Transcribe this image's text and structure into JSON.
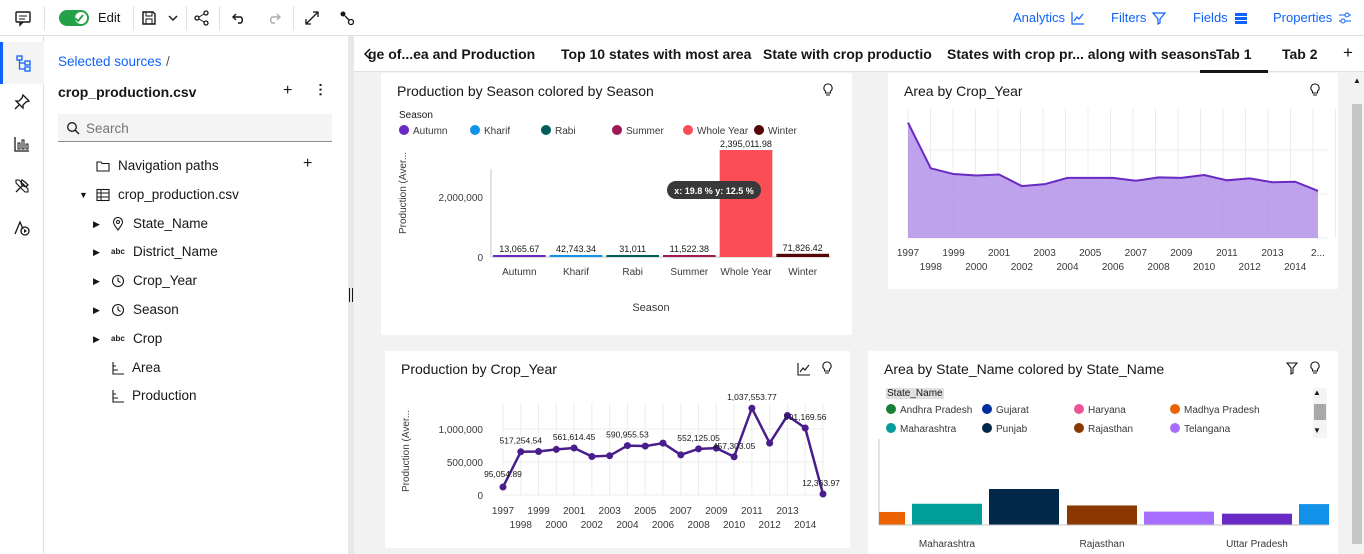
{
  "toolbar": {
    "edit_label": "Edit",
    "analytics_label": "Analytics",
    "filters_label": "Filters",
    "fields_label": "Fields",
    "properties_label": "Properties"
  },
  "panel": {
    "breadcrumb": "Selected sources",
    "breadcrumb_sep": "/",
    "source_title": "crop_production.csv",
    "search_placeholder": "Search",
    "tree": [
      {
        "label": "Navigation paths",
        "icon": "folder-icon"
      },
      {
        "label": "crop_production.csv",
        "icon": "table-icon"
      },
      {
        "label": "State_Name",
        "icon": "location-icon"
      },
      {
        "label": "District_Name",
        "icon": "abc-icon"
      },
      {
        "label": "Crop_Year",
        "icon": "clock-icon"
      },
      {
        "label": "Season",
        "icon": "clock-icon"
      },
      {
        "label": "Crop",
        "icon": "abc-icon"
      },
      {
        "label": "Area",
        "icon": "measure-icon"
      },
      {
        "label": "Production",
        "icon": "measure-icon"
      }
    ]
  },
  "tabs": [
    "ge of...ea and Production",
    "Top 10 states with most area",
    "State with crop productio",
    "States with crop pr... along with seasons",
    "Tab 1",
    "Tab 2"
  ],
  "active_tab": "Tab 1",
  "colors": {
    "accent": "#0f62fe",
    "purple": "#6929c4",
    "area_fill": "#b392e8"
  },
  "charts": {
    "season": {
      "title": "Production by Season colored by Season",
      "legend_title": "Season",
      "ylabel": "Production (Aver...",
      "xlabel": "Season",
      "tooltip": "x: 19.8 %  y: 12.5 %",
      "y_ticks": [
        "2,000,000",
        "0"
      ]
    },
    "area_year": {
      "title": "Area by Crop_Year",
      "x_top": [
        "1997",
        "1999",
        "2001",
        "2003",
        "2005",
        "2007",
        "2009",
        "2011",
        "2013",
        "2..."
      ],
      "x_bottom": [
        "1998",
        "2000",
        "2002",
        "2004",
        "2006",
        "2008",
        "2010",
        "2012",
        "2014"
      ]
    },
    "prod_year": {
      "title": "Production by Crop_Year",
      "ylabel": "Production (Aver...",
      "y_ticks": [
        "1,000,000",
        "500,000",
        "0"
      ],
      "x_top": [
        "1997",
        "1999",
        "2001",
        "2003",
        "2005",
        "2007",
        "2009",
        "2011",
        "2013"
      ],
      "x_bottom": [
        "1998",
        "2000",
        "2002",
        "2004",
        "2006",
        "2008",
        "2010",
        "2012",
        "2014"
      ],
      "labels": [
        "95,054.89",
        "517,254.54",
        "561,614.45",
        "590,955.53",
        "552,125.05",
        "457,303.05",
        "1,037,553.77",
        "801,169.56",
        "12,363.97"
      ]
    },
    "state": {
      "title": "Area by State_Name colored by State_Name",
      "legend_title": "State_Name",
      "x_labels": [
        "Maharashtra",
        "Rajasthan",
        "Uttar Pradesh"
      ]
    }
  },
  "chart_data": [
    {
      "type": "bar",
      "title": "Production by Season colored by Season",
      "xlabel": "Season",
      "ylabel": "Production (Aver...",
      "categories": [
        "Autumn",
        "Kharif",
        "Rabi",
        "Summer",
        "Whole Year",
        "Winter"
      ],
      "values": [
        13065.67,
        42743.34,
        31011,
        11522.38,
        2395011.98,
        71826.42
      ],
      "value_labels": [
        "13,065.67",
        "42,743.34",
        "31,011",
        "11,522.38",
        "2,395,011.98",
        "71,826.42"
      ],
      "colors": [
        "#6929c4",
        "#1192e8",
        "#005d5d",
        "#9f1853",
        "#fa4d56",
        "#570408"
      ],
      "ylim": [
        0,
        3000000
      ],
      "legend": "top"
    },
    {
      "type": "area",
      "title": "Area by Crop_Year",
      "x": [
        1997,
        1998,
        1999,
        2000,
        2001,
        2002,
        2003,
        2004,
        2005,
        2006,
        2007,
        2008,
        2009,
        2010,
        2011,
        2012,
        2013,
        2014,
        2015
      ],
      "values": [
        2400000,
        1450000,
        1330000,
        1300000,
        1320000,
        1080000,
        1120000,
        1250000,
        1250000,
        1250000,
        1190000,
        1260000,
        1250000,
        1310000,
        1200000,
        1240000,
        1160000,
        1170000,
        980000
      ],
      "ylim": [
        0,
        2600000
      ]
    },
    {
      "type": "line",
      "title": "Production by Crop_Year",
      "ylabel": "Production (Aver...",
      "x": [
        1997,
        1998,
        1999,
        2000,
        2001,
        2002,
        2003,
        2004,
        2005,
        2006,
        2007,
        2008,
        2009,
        2010,
        2011,
        2012,
        2013,
        2014,
        2015
      ],
      "values": [
        95054.89,
        517254.54,
        520000,
        545000,
        561614.45,
        460000,
        470000,
        590955.53,
        585000,
        620000,
        480000,
        552125.05,
        560000,
        457303.05,
        1037553.77,
        620000,
        950000,
        801169.56,
        12363.97
      ],
      "ylim": [
        0,
        1100000
      ]
    },
    {
      "type": "bar",
      "title": "Area by State_Name colored by State_Name",
      "legend": "top",
      "series_names": [
        "Andhra Pradesh",
        "Gujarat",
        "Haryana",
        "Madhya Pradesh",
        "Maharashtra",
        "Punjab",
        "Rajasthan",
        "Telangana"
      ],
      "legend_colors": [
        "#198038",
        "#002d9c",
        "#ee5396",
        "#eb6200",
        "#009d9a",
        "#012749",
        "#8a3800",
        "#a56eff"
      ],
      "values": [
        380000,
        620000,
        1050000,
        570000,
        390000,
        330000,
        610000
      ],
      "colors": [
        "#eb6200",
        "#009d9a",
        "#012749",
        "#8a3800",
        "#a56eff",
        "#6929c4",
        "#1192e8"
      ]
    }
  ]
}
